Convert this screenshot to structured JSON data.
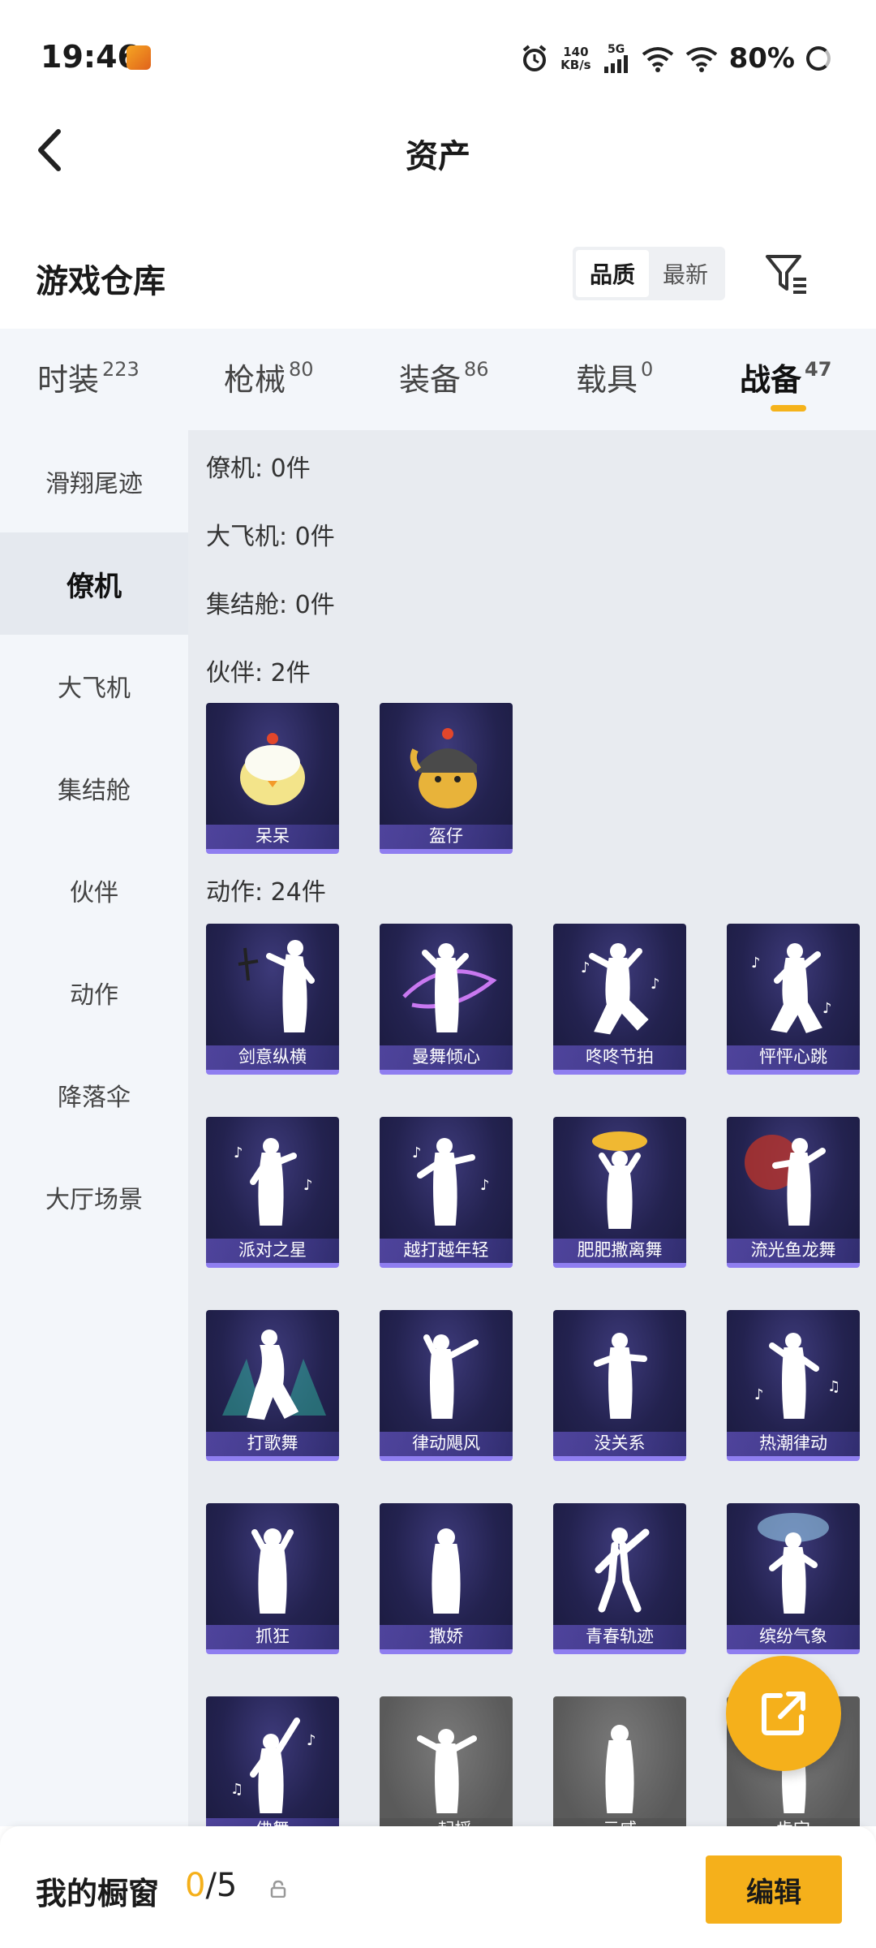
{
  "status_bar": {
    "time": "19:46",
    "net_speed_value": "140",
    "net_speed_unit": "KB/s",
    "net_type": "5G",
    "battery": "80%"
  },
  "header": {
    "title": "资产",
    "back_icon": "chevron-left-icon"
  },
  "warehouse": {
    "title": "游戏仓库",
    "sort_options": [
      "品质",
      "最新"
    ],
    "selected_sort": "品质",
    "filter_icon": "filter-icon"
  },
  "tabs": [
    {
      "label": "时装",
      "count": "223"
    },
    {
      "label": "枪械",
      "count": "80"
    },
    {
      "label": "装备",
      "count": "86"
    },
    {
      "label": "载具",
      "count": "0"
    },
    {
      "label": "战备",
      "count": "47"
    }
  ],
  "active_tab": "战备",
  "sidebar": [
    "滑翔尾迹",
    "僚机",
    "大飞机",
    "集结舱",
    "伙伴",
    "动作",
    "降落伞",
    "大厅场景"
  ],
  "active_sidebar": "僚机",
  "sections": [
    {
      "title": "僚机: 0件"
    },
    {
      "title": "大飞机: 0件"
    },
    {
      "title": "集结舱: 0件"
    },
    {
      "title": "伙伴: 2件",
      "items": [
        "呆呆",
        "盔仔"
      ]
    },
    {
      "title": "动作: 24件",
      "items": [
        "剑意纵横",
        "曼舞倾心",
        "咚咚节拍",
        "怦怦心跳",
        "派对之星",
        "越打越年轻",
        "肥肥撒离舞",
        "流光鱼龙舞",
        "打歌舞",
        "律动飓风",
        "没关系",
        "热潮律动",
        "抓狂",
        "撒娇",
        "青春轨迹",
        "缤纷气象",
        "佛舞",
        "一起摇",
        "示威",
        "肯定"
      ]
    }
  ],
  "fab_icon": "share-external-icon",
  "bottom_bar": {
    "label": "我的橱窗",
    "count_current": "0",
    "count_total": "/5",
    "lock_icon": "lock-icon",
    "edit_label": "编辑"
  }
}
